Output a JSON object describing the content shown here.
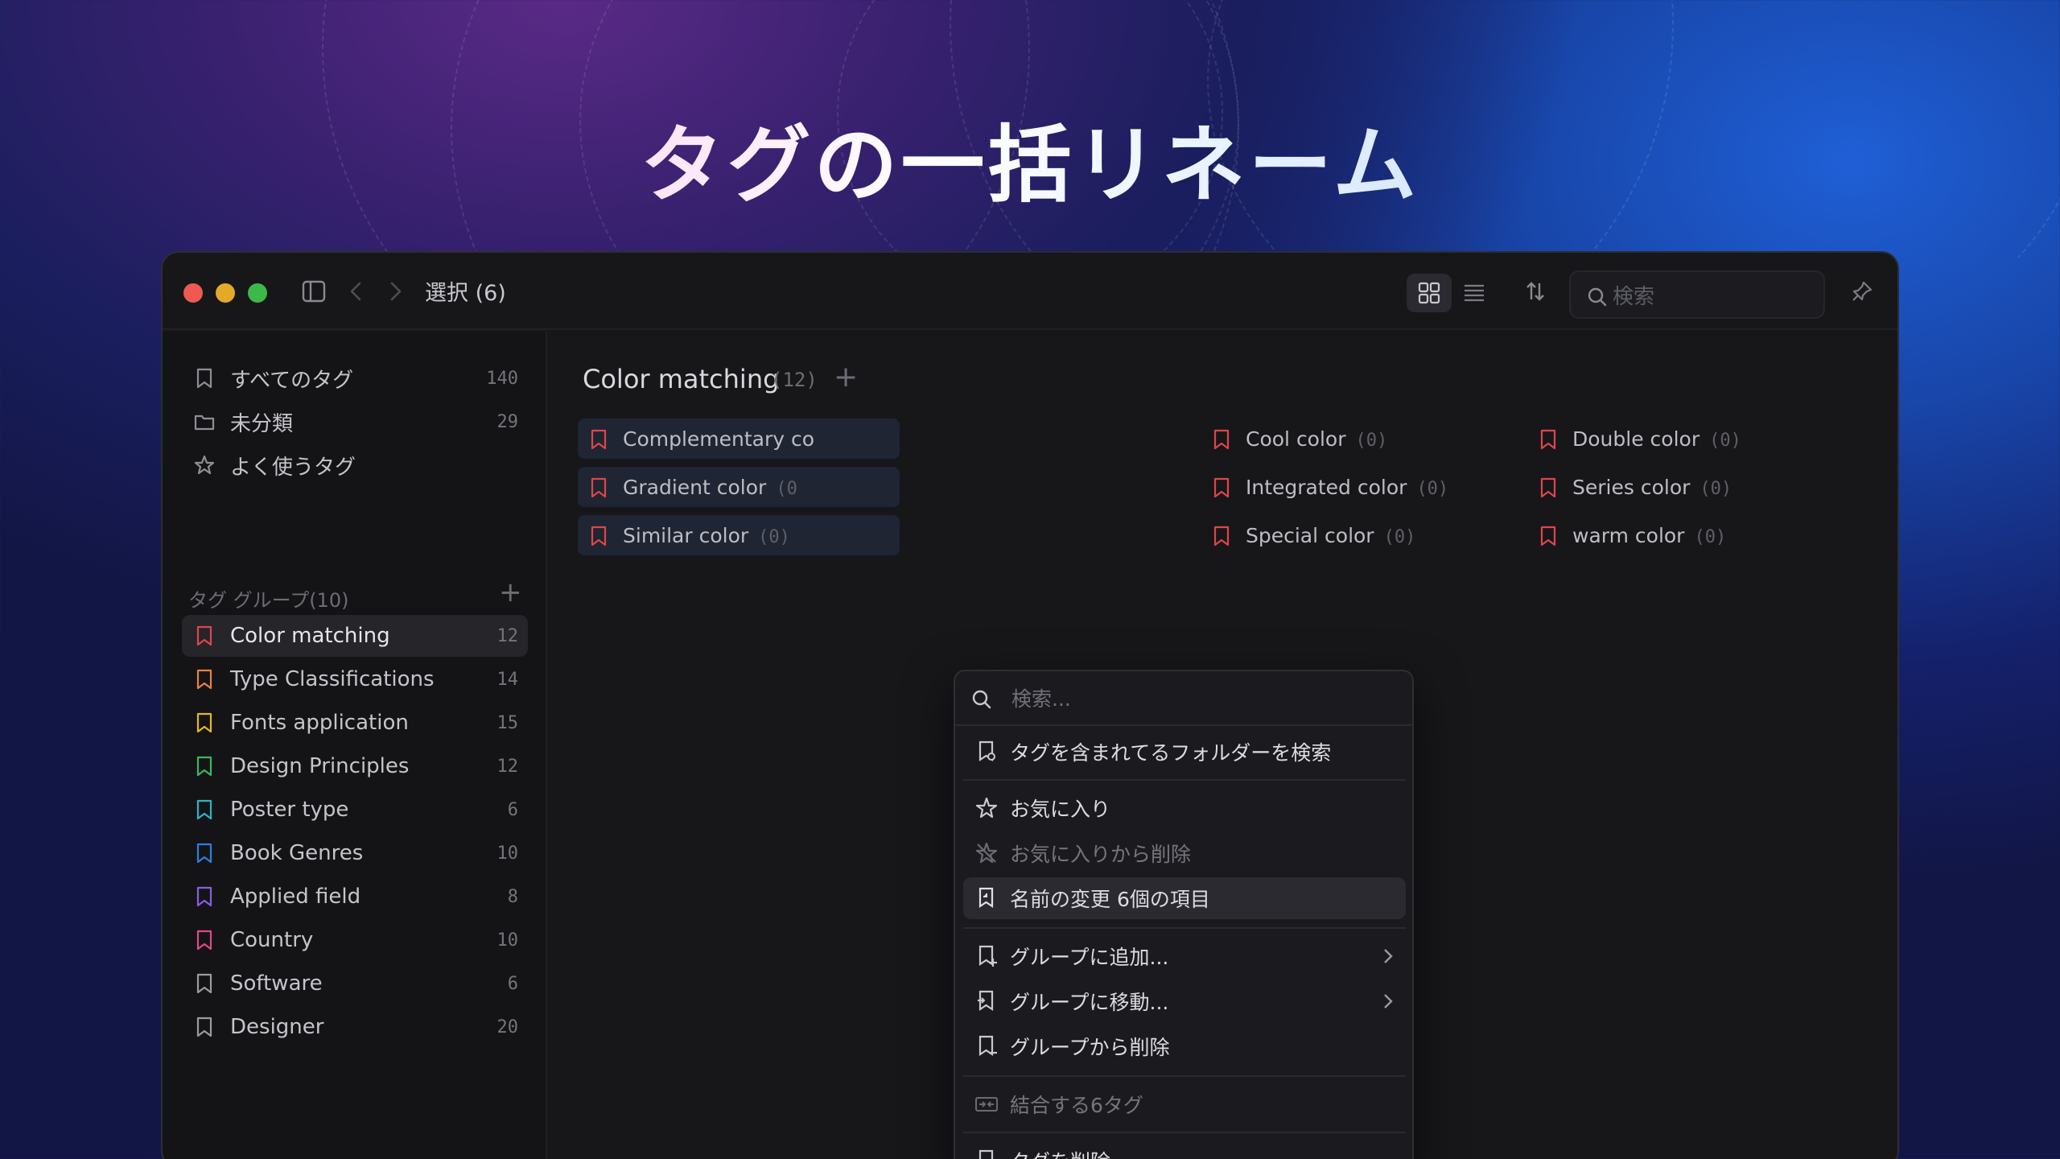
{
  "hero": {
    "title": "タグの一括リネーム"
  },
  "toolbar": {
    "title": "選択 (6)",
    "search_placeholder": "検索"
  },
  "sidebar": {
    "top_items": [
      {
        "label": "すべてのタグ",
        "count": "140",
        "icon": "bookmark-icon"
      },
      {
        "label": "未分類",
        "count": "29",
        "icon": "folder-icon"
      },
      {
        "label": "よく使うタグ",
        "count": "",
        "icon": "star-icon"
      }
    ],
    "group_header": "タグ グループ(10)",
    "groups": [
      {
        "label": "Color matching",
        "count": "12",
        "color": "#e0454a"
      },
      {
        "label": "Type Classifications",
        "count": "14",
        "color": "#e8833a"
      },
      {
        "label": "Fonts application",
        "count": "15",
        "color": "#e5b52c"
      },
      {
        "label": "Design Principles",
        "count": "12",
        "color": "#3cb85c"
      },
      {
        "label": "Poster type",
        "count": "6",
        "color": "#2fb3c4"
      },
      {
        "label": "Book Genres",
        "count": "10",
        "color": "#2f7fe0"
      },
      {
        "label": "Applied field",
        "count": "8",
        "color": "#8a5ee0"
      },
      {
        "label": "Country",
        "count": "10",
        "color": "#e0488a"
      },
      {
        "label": "Software",
        "count": "6",
        "color": "#9a9aa2"
      },
      {
        "label": "Designer",
        "count": "20",
        "color": "#9a9aa2"
      }
    ]
  },
  "main": {
    "title": "Color matching",
    "count": "(12)",
    "tags": [
      {
        "label": "Complementary co",
        "count": "",
        "selected": true
      },
      {
        "label": "Gradient color",
        "count": "(0",
        "selected": true
      },
      {
        "label": "Similar color",
        "count": "(0)",
        "selected": true
      },
      {
        "label": "Cool color",
        "count": "(0)",
        "selected": false
      },
      {
        "label": "Integrated color",
        "count": "(0)",
        "selected": false
      },
      {
        "label": "Special color",
        "count": "(0)",
        "selected": false
      },
      {
        "label": "Double color",
        "count": "(0)",
        "selected": false
      },
      {
        "label": "Series color",
        "count": "(0)",
        "selected": false
      },
      {
        "label": "warm color",
        "count": "(0)",
        "selected": false
      }
    ]
  },
  "context_menu": {
    "search_placeholder": "検索...",
    "items": [
      {
        "label": "タグを含まれてるフォルダーを検索",
        "icon": "folder-search-icon",
        "disabled": false
      },
      {
        "label": "お気に入り",
        "icon": "star-icon",
        "disabled": false
      },
      {
        "label": "お気に入りから削除",
        "icon": "star-off-icon",
        "disabled": true
      },
      {
        "label": "名前の変更 6個の項目",
        "icon": "rename-icon",
        "disabled": false,
        "highlighted": true
      },
      {
        "label": "グループに追加...",
        "icon": "group-add-icon",
        "disabled": false,
        "submenu": true
      },
      {
        "label": "グループに移動...",
        "icon": "group-move-icon",
        "disabled": false,
        "submenu": true
      },
      {
        "label": "グループから削除",
        "icon": "group-remove-icon",
        "disabled": false
      },
      {
        "label": "結合する6タグ",
        "icon": "merge-icon",
        "disabled": true
      },
      {
        "label": "タグを削除",
        "icon": "tag-delete-icon",
        "disabled": false
      }
    ]
  },
  "colors": {
    "tag_red": "#e0454a",
    "accent_selected_bg": "#1f2533"
  }
}
